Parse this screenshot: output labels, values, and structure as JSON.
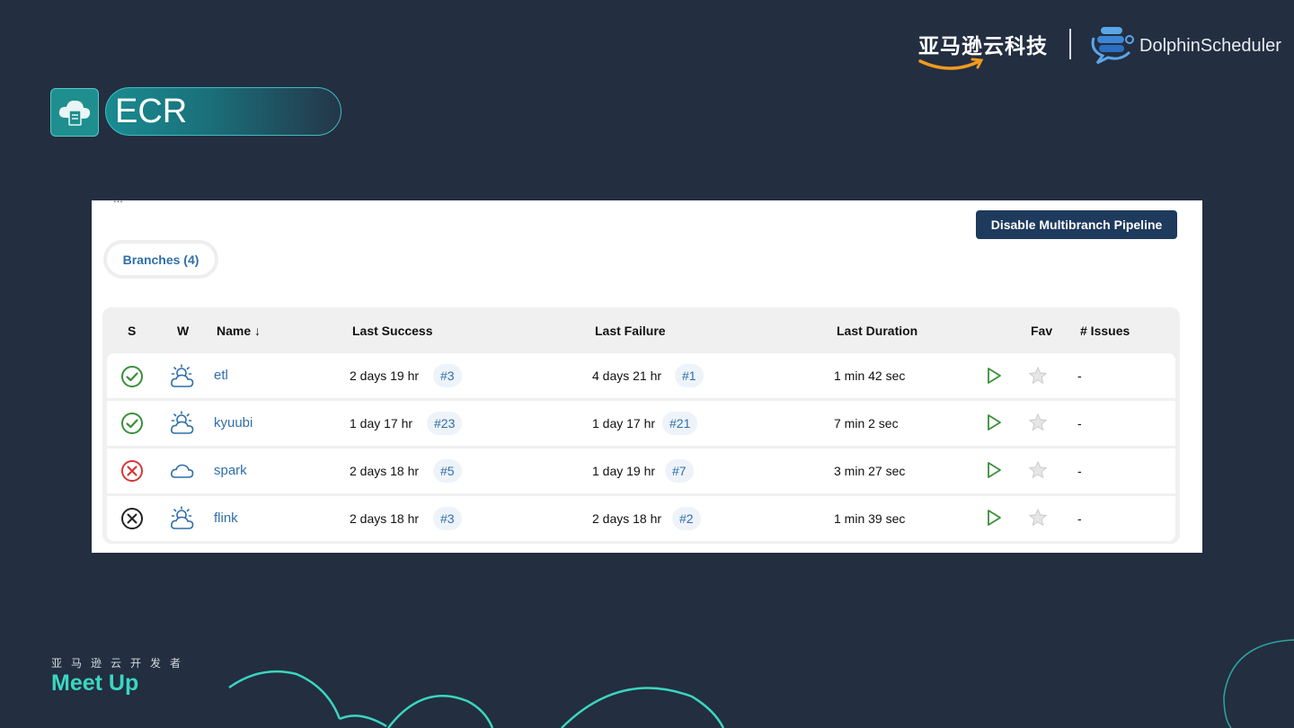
{
  "header": {
    "amazon_brand": "亚马逊云科技",
    "ds_brand": "DolphinScheduler"
  },
  "slide": {
    "title": "ECR"
  },
  "panel": {
    "cut_text": "...",
    "disable_button": "Disable Multibranch Pipeline",
    "branches_tab": "Branches (4)",
    "columns": {
      "s": "S",
      "w": "W",
      "name": "Name ↓",
      "last_success": "Last Success",
      "last_failure": "Last Failure",
      "last_duration": "Last Duration",
      "fav": "Fav",
      "issues": "# Issues"
    },
    "rows": [
      {
        "status": "success",
        "weather": "sunny-cloud-icon",
        "name": "etl",
        "last_success": "2 days 19 hr",
        "success_build": "#3",
        "last_failure": "4 days 21 hr",
        "failure_build": "#1",
        "duration": "1 min 42 sec",
        "issues": "-"
      },
      {
        "status": "success",
        "weather": "sunny-cloud-icon",
        "name": "kyuubi",
        "last_success": "1 day 17 hr",
        "success_build": "#23",
        "last_failure": "1 day 17 hr",
        "failure_build": "#21",
        "duration": "7 min 2 sec",
        "issues": "-"
      },
      {
        "status": "failed",
        "weather": "cloud-icon",
        "name": "spark",
        "last_success": "2 days 18 hr",
        "success_build": "#5",
        "last_failure": "1 day 19 hr",
        "failure_build": "#7",
        "duration": "3 min 27 sec",
        "issues": "-"
      },
      {
        "status": "aborted",
        "weather": "sunny-cloud-icon",
        "name": "flink",
        "last_success": "2 days 18 hr",
        "success_build": "#3",
        "last_failure": "2 days 18 hr",
        "failure_build": "#2",
        "duration": "1 min 39 sec",
        "issues": "-"
      }
    ]
  },
  "footer": {
    "meetup_cn": "亚马逊云开发者",
    "meetup": "Meet Up"
  },
  "colors": {
    "background": "#232e40",
    "accent_teal": "#3ad6c0",
    "success": "#3a8f3a",
    "failure": "#d93636",
    "link": "#2f6faa",
    "button": "#1e3a5c"
  }
}
